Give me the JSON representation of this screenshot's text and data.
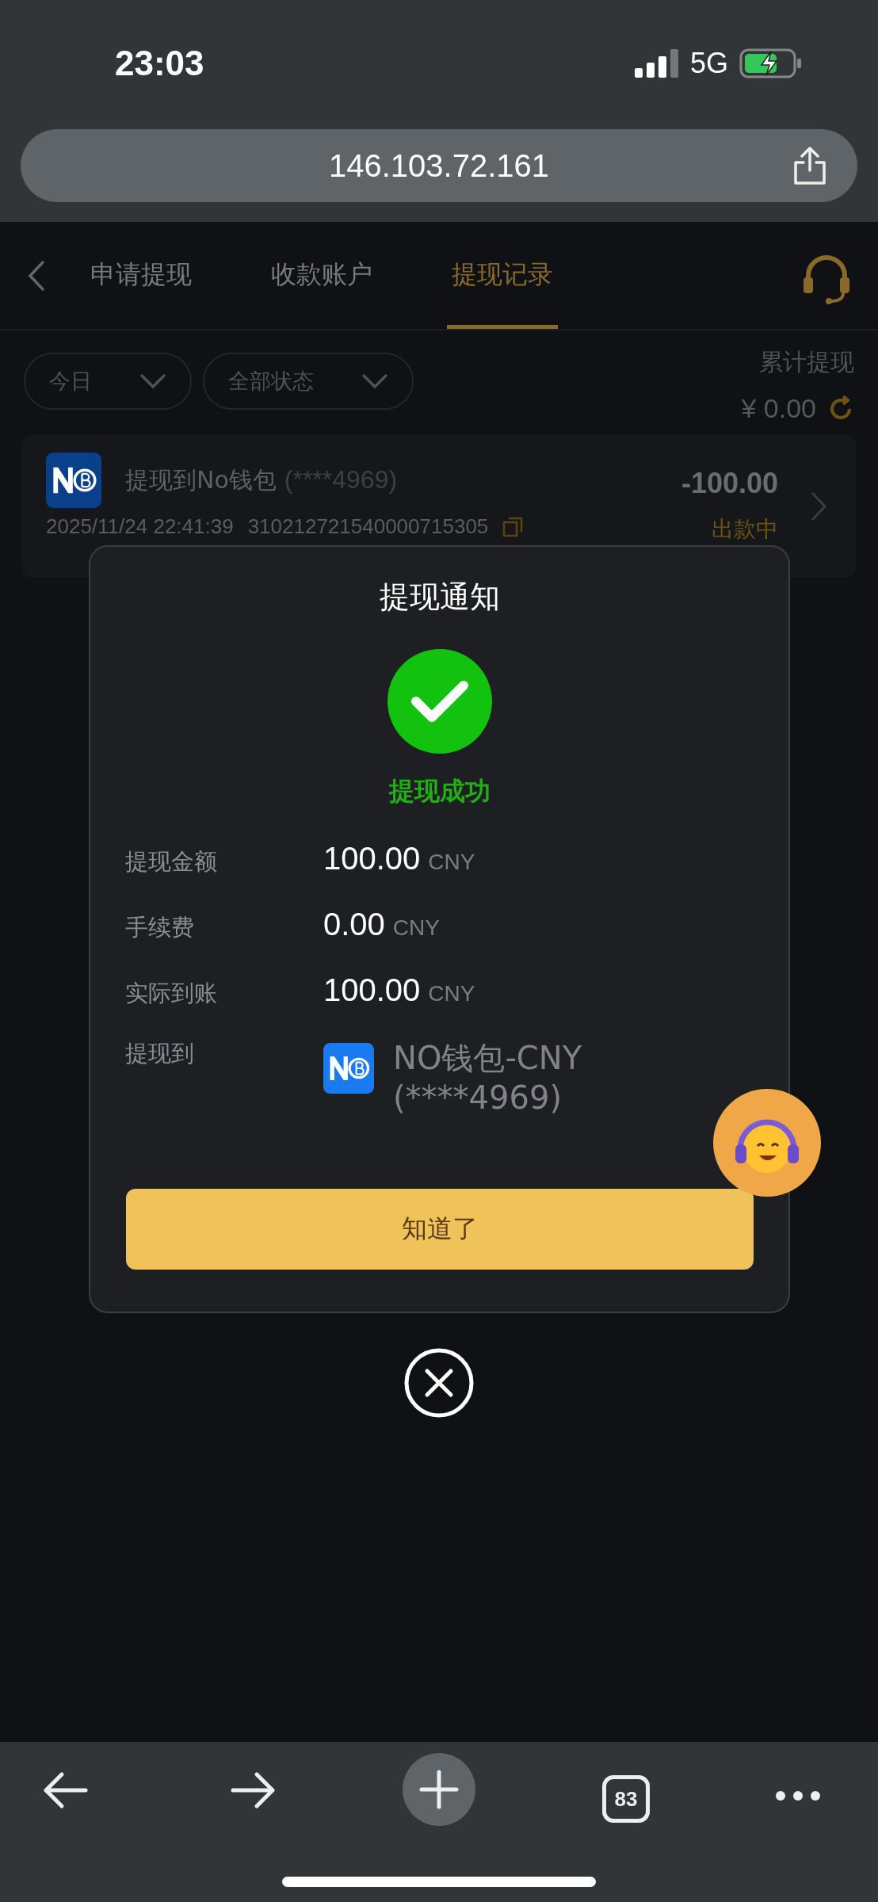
{
  "status_bar": {
    "time": "23:03",
    "network": "5G"
  },
  "browser": {
    "url": "146.103.72.161",
    "tab_count": "83"
  },
  "header": {
    "tabs": [
      {
        "label": "申请提现",
        "selected": false
      },
      {
        "label": "收款账户",
        "selected": false
      },
      {
        "label": "提现记录",
        "selected": true
      }
    ]
  },
  "filters": [
    {
      "label": "今日"
    },
    {
      "label": "全部状态"
    }
  ],
  "summary": {
    "label": "累计提现",
    "total": "¥ 0.00"
  },
  "record": {
    "title": "提现到No钱包",
    "account": "(****4969)",
    "datetime": "2025/11/24 22:41:39",
    "order_no": "310212721540000715305",
    "amount": "-100.00",
    "status": "出款中"
  },
  "modal": {
    "title": "提现通知",
    "result": "提现成功",
    "rows": [
      {
        "label": "提现金额",
        "value": "100.00",
        "unit": "CNY"
      },
      {
        "label": "手续费",
        "value": "0.00",
        "unit": "CNY"
      },
      {
        "label": "实际到账",
        "value": "100.00",
        "unit": "CNY"
      }
    ],
    "destination": {
      "label": "提现到",
      "name": "NO钱包-CNY",
      "account": "(****4969)"
    },
    "button": "知道了"
  }
}
